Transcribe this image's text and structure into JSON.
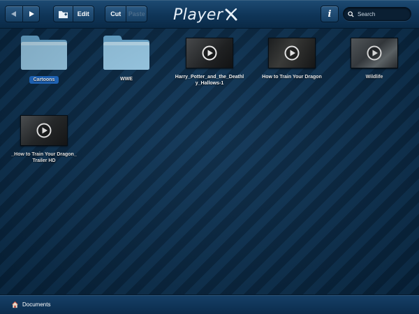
{
  "toolbar": {
    "edit_label": "Edit",
    "cut_label": "Cut",
    "paste_label": "Paste",
    "logo_text": "Player",
    "info_label": "i",
    "search_placeholder": "Search"
  },
  "items": [
    {
      "name": "Cartoons",
      "kind": "folder",
      "selected": true
    },
    {
      "name": "WWE",
      "kind": "folder",
      "selected": false
    },
    {
      "name": "Harry_Potter_and_the_Deathly_Hallows-1",
      "kind": "video",
      "selected": false
    },
    {
      "name": "How to Train Your Dragon",
      "kind": "video",
      "selected": false
    },
    {
      "name": "Wildlife",
      "kind": "video",
      "selected": false
    },
    {
      "name": "_How to Train Your Dragon_ Trailer HD",
      "kind": "video",
      "selected": false
    }
  ],
  "bottom": {
    "location_label": "Documents"
  },
  "colors": {
    "accent": "#1f6fd0",
    "background": "#0b2e4e",
    "folder": "#8ec9ec"
  },
  "icons": {
    "back": "back-arrow-icon",
    "forward": "forward-arrow-icon",
    "new_folder": "new-folder-icon",
    "info": "info-icon",
    "search": "search-icon",
    "folder": "folder-icon",
    "play": "play-icon",
    "home": "home-icon",
    "logo_mark": "x-logo-icon"
  }
}
